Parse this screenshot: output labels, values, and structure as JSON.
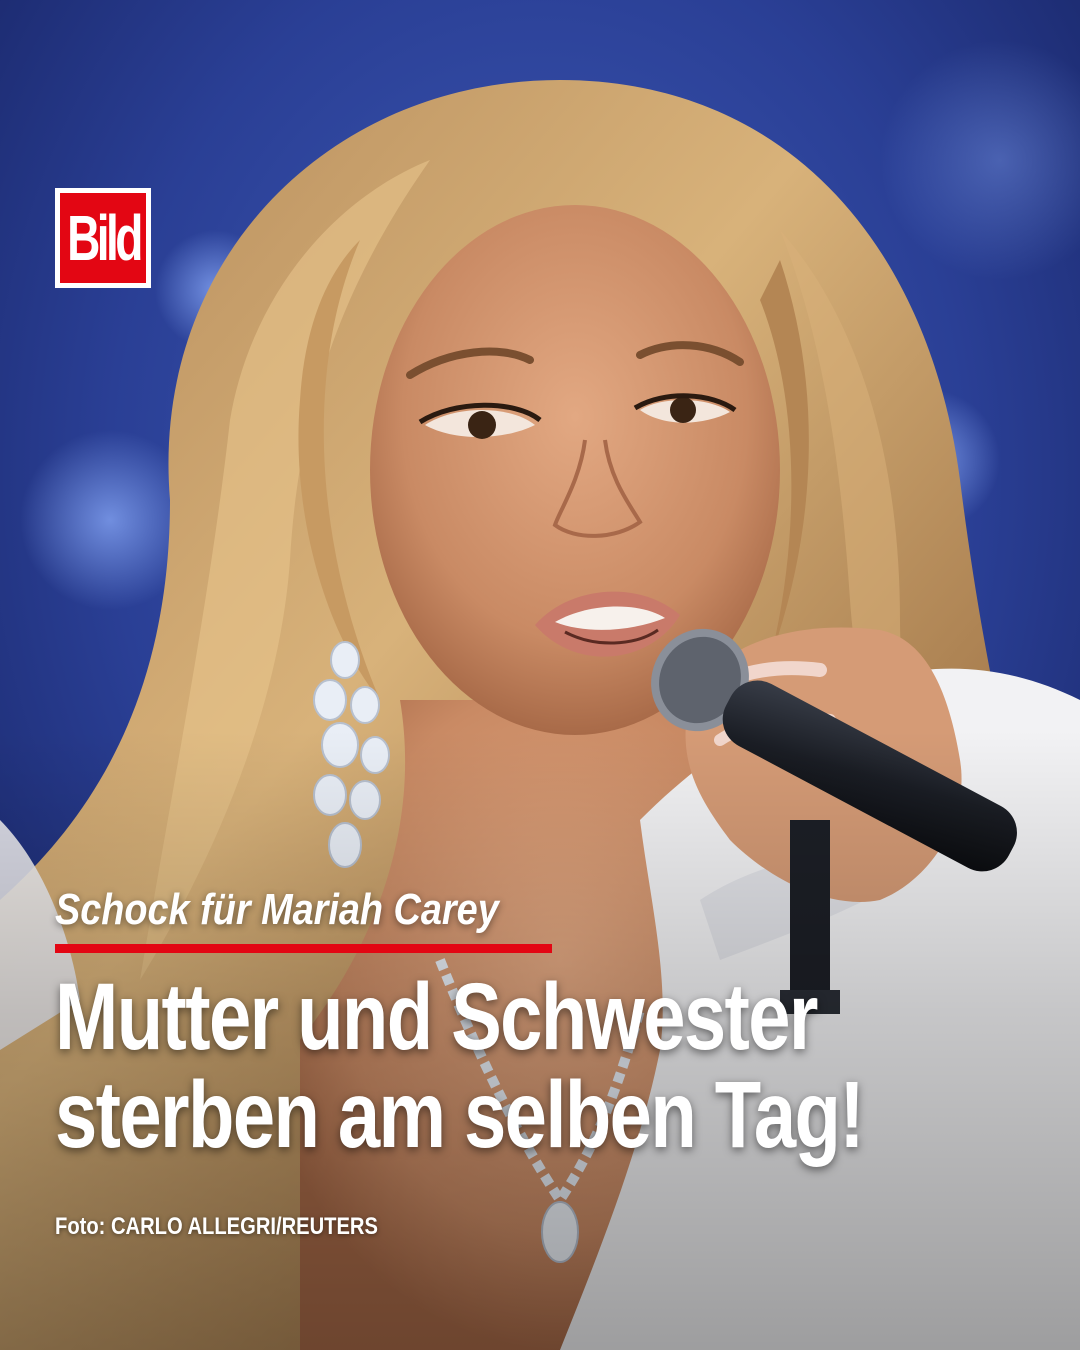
{
  "brand": {
    "logo_text": "Bild",
    "logo_color": "#e30613"
  },
  "post": {
    "kicker": "Schock für Mariah Carey",
    "headline_line1": "Mutter und Schwester",
    "headline_line2": "sterben am selben Tag!",
    "photo_credit": "Foto: CARLO ALLEGRI/REUTERS"
  },
  "colors": {
    "accent": "#e30613",
    "text": "#ffffff",
    "background_blue": "#1b2a6a"
  }
}
